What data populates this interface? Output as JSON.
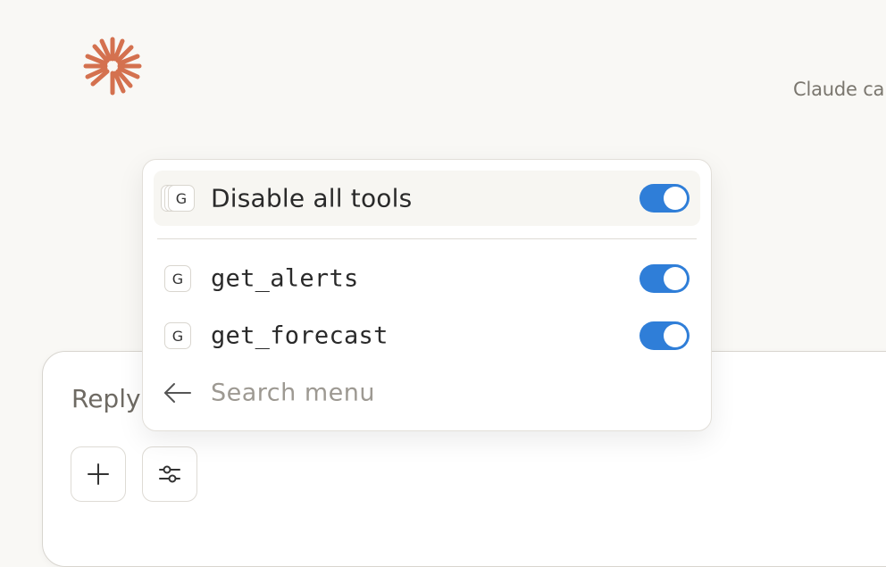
{
  "header": {
    "brand_logo": "claude-asterisk-logo",
    "top_note": "Claude ca"
  },
  "composer": {
    "placeholder": "Reply",
    "add_button_icon": "plus-icon",
    "tools_button_icon": "sliders-icon"
  },
  "tools_menu": {
    "disable_all": {
      "label": "Disable all tools",
      "icon_letter": "G",
      "enabled": true
    },
    "tools": [
      {
        "label": "get_alerts",
        "icon_letter": "G",
        "enabled": true
      },
      {
        "label": "get_forecast",
        "icon_letter": "G",
        "enabled": true
      }
    ],
    "search": {
      "placeholder": "Search menu",
      "back_icon": "arrow-left-icon"
    }
  },
  "colors": {
    "background": "#f9f8f5",
    "accent_logo": "#d4714f",
    "toggle_on": "#2f7ed8"
  }
}
